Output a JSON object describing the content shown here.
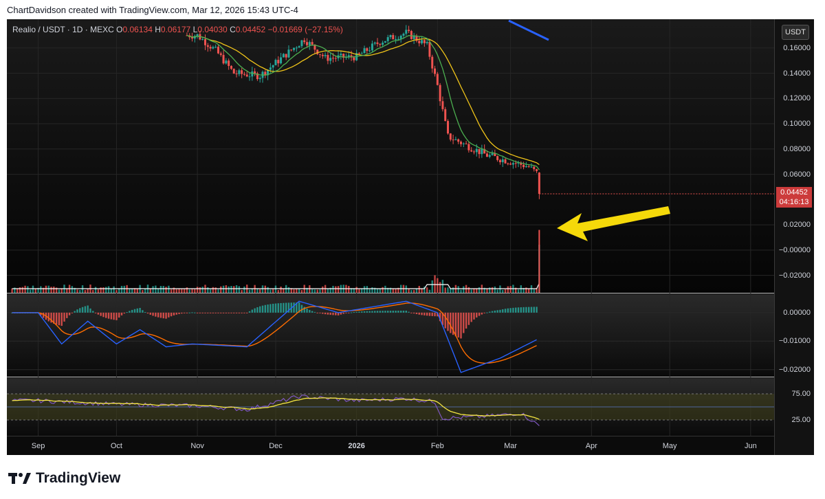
{
  "header": {
    "attribution": "ChartDavidson created with TradingView.com, Mar 12, 2026 15:43 UTC-4"
  },
  "legend": {
    "symbol": "Realio / USDT · 1D · MEXC",
    "o_label": "O",
    "o_value": "0.06134",
    "h_label": "H",
    "h_value": "0.06177",
    "l_label": "L",
    "l_value": "0.04030",
    "c_label": "C",
    "c_value": "0.04452",
    "change": "−0.01669 (−27.15%)"
  },
  "price_axis": {
    "currency_button": "USDT",
    "last_price": "0.04452",
    "countdown": "04:16:13",
    "main_ticks": [
      "0.16000",
      "0.14000",
      "0.12000",
      "0.10000",
      "0.08000",
      "0.06000",
      "0.02000",
      "−0.00000",
      "−0.02000"
    ],
    "macd_ticks": [
      "0.00000",
      "−0.01000",
      "−0.02000"
    ],
    "rsi_ticks": [
      "75.00",
      "25.00"
    ]
  },
  "time_axis": [
    "Sep",
    "Oct",
    "Nov",
    "Dec",
    "2026",
    "Feb",
    "Mar",
    "Apr",
    "May",
    "Jun"
  ],
  "footer": {
    "brand": "TradingView",
    "logo_text": "TV"
  },
  "colors": {
    "up": "#26a69a",
    "down": "#ef5350",
    "ma_fast": "#4caf50",
    "ma_slow": "#f0c419",
    "macd": "#2962ff",
    "signal": "#ff6d00",
    "rsi": "#7e57c2",
    "rsi_ma": "#f5e642",
    "arrow": "#f5d90a",
    "trend": "#2962ff",
    "volume_ma": "#ffffff"
  },
  "chart_data": {
    "type": "candlestick",
    "symbol": "Realio / USDT",
    "interval": "1D",
    "exchange": "MEXC",
    "price_axis_range": [
      -0.03,
      0.18
    ],
    "x_months": [
      "Sep",
      "Oct",
      "Nov",
      "Dec",
      "2026",
      "Feb",
      "Mar",
      "Apr",
      "May",
      "Jun"
    ],
    "price_trajectory": [
      [
        "2025-11-01",
        0.17
      ],
      [
        "2025-11-08",
        0.158
      ],
      [
        "2025-11-15",
        0.14
      ],
      [
        "2025-11-25",
        0.138
      ],
      [
        "2025-12-05",
        0.155
      ],
      [
        "2025-12-12",
        0.167
      ],
      [
        "2025-12-20",
        0.152
      ],
      [
        "2026-01-01",
        0.153
      ],
      [
        "2026-01-10",
        0.165
      ],
      [
        "2026-01-20",
        0.172
      ],
      [
        "2026-01-28",
        0.162
      ],
      [
        "2026-02-01",
        0.13
      ],
      [
        "2026-02-05",
        0.09
      ],
      [
        "2026-02-10",
        0.085
      ],
      [
        "2026-02-20",
        0.075
      ],
      [
        "2026-03-01",
        0.07
      ],
      [
        "2026-03-08",
        0.066
      ],
      [
        "2026-03-11",
        0.061
      ],
      [
        "2026-03-12",
        0.04452
      ]
    ],
    "last_candle": {
      "open": 0.06134,
      "high": 0.06177,
      "low": 0.0403,
      "close": 0.04452,
      "change": -0.01669,
      "change_pct": -27.15
    },
    "volume_spike_date": "2026-03-12",
    "macd_range": [
      -0.022,
      0.006
    ],
    "macd_trajectory": [
      [
        "2025-09-01",
        0.0
      ],
      [
        "2025-09-10",
        -0.011
      ],
      [
        "2025-09-20",
        -0.003
      ],
      [
        "2025-10-01",
        -0.011
      ],
      [
        "2025-10-10",
        -0.006
      ],
      [
        "2025-10-20",
        -0.012
      ],
      [
        "2025-10-30",
        -0.011
      ],
      [
        "2025-11-20",
        -0.012
      ],
      [
        "2025-12-10",
        0.004
      ],
      [
        "2025-12-25",
        0.0
      ],
      [
        "2026-01-20",
        0.004
      ],
      [
        "2026-02-01",
        0.0
      ],
      [
        "2026-02-10",
        -0.021
      ],
      [
        "2026-02-25",
        -0.016
      ],
      [
        "2026-03-11",
        -0.0095
      ]
    ],
    "rsi_range": [
      0,
      100
    ],
    "rsi_levels": [
      75,
      25
    ],
    "rsi_trajectory": [
      [
        "2025-09-01",
        62
      ],
      [
        "2025-10-01",
        55
      ],
      [
        "2025-11-01",
        52
      ],
      [
        "2025-11-20",
        45
      ],
      [
        "2025-12-10",
        70
      ],
      [
        "2026-01-01",
        62
      ],
      [
        "2026-01-20",
        66
      ],
      [
        "2026-01-31",
        60
      ],
      [
        "2026-02-03",
        28
      ],
      [
        "2026-02-20",
        32
      ],
      [
        "2026-03-05",
        38
      ],
      [
        "2026-03-12",
        14
      ]
    ]
  }
}
